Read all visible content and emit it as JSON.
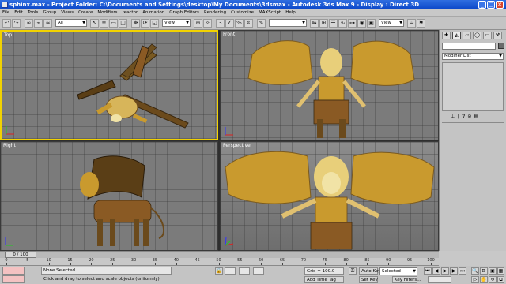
{
  "window": {
    "title": "sphinx.max    - Project Folder: C:\\Documents and Settings\\desktop\\My Documents\\3dsmax    - Autodesk 3ds Max 9    - Display : Direct 3D",
    "minimize": "_",
    "maximize": "□",
    "close": "✕"
  },
  "menu": [
    "File",
    "Edit",
    "Tools",
    "Group",
    "Views",
    "Create",
    "Modifiers",
    "reactor",
    "Animation",
    "Graph Editors",
    "Rendering",
    "Customize",
    "MAXScript",
    "Help"
  ],
  "toolbar": {
    "selection_filter": "All",
    "ref_coord": "View"
  },
  "viewports": {
    "top": "Top",
    "front": "Front",
    "right": "Right",
    "perspective": "Perspective"
  },
  "command_panel": {
    "tabs": [
      "✚",
      "◭",
      "▱",
      "◯",
      "▭",
      "⚒"
    ],
    "modifier_list": "Modifier List"
  },
  "timeline": {
    "frame_display": "0 / 100",
    "ticks": [
      "0",
      "5",
      "10",
      "15",
      "20",
      "25",
      "30",
      "35",
      "40",
      "45",
      "50",
      "55",
      "60",
      "65",
      "70",
      "75",
      "80",
      "85",
      "90",
      "95",
      "100"
    ]
  },
  "status": {
    "selection": "None Selected",
    "prompt": "Click and drag to select and scale objects (uniformly)",
    "grid": "Grid = 100.0",
    "add_time_tag": "Add Time Tag",
    "auto_key": "Auto Key",
    "set_key": "Set Key",
    "selected_dropdown": "Selected",
    "key_filters": "Key Filters..."
  },
  "colors": {
    "active_viewport_border": "#f2d200",
    "viewport_bg": "#7b7b7b",
    "titlebar": "#0a46c8",
    "model_gold": "#c99a2e",
    "model_dark": "#6b4a1c"
  }
}
